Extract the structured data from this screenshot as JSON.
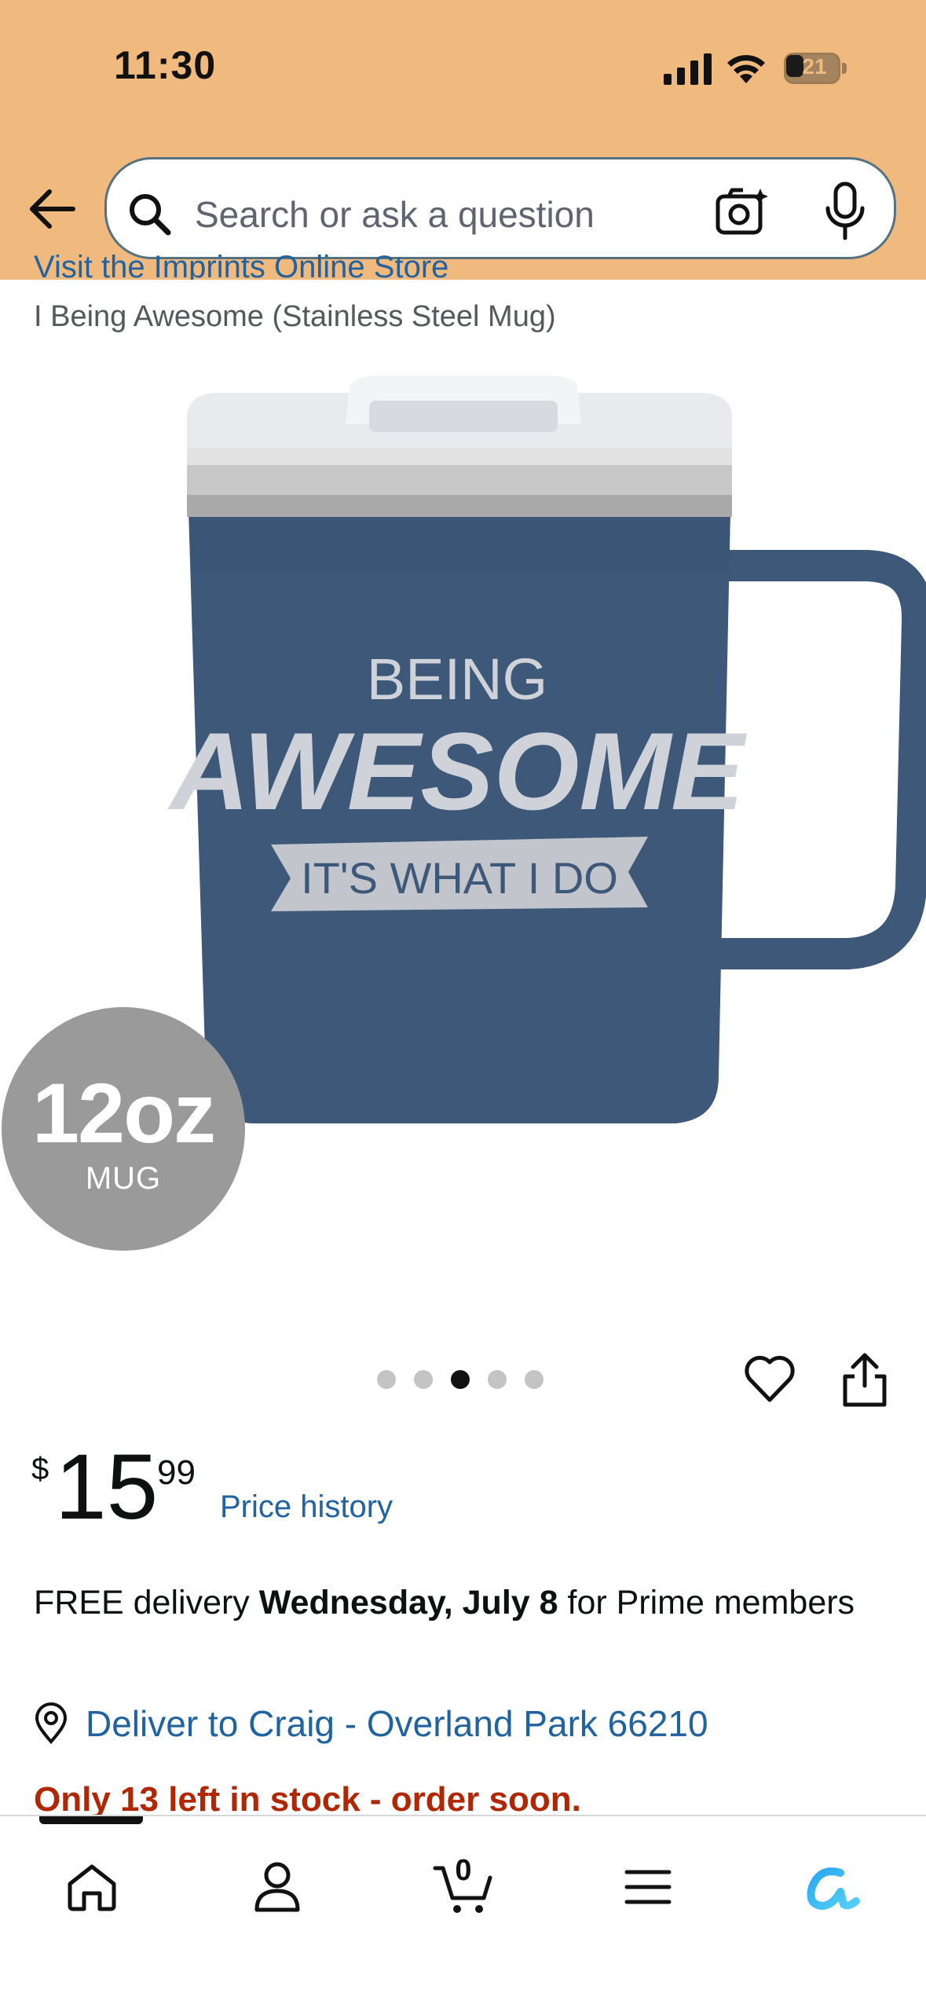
{
  "status_bar": {
    "time": "11:30",
    "battery_level": "21"
  },
  "search": {
    "placeholder": "Search or ask a question"
  },
  "store_link": "Visit the Imprints Online Store",
  "product_title": "I Being Awesome (Stainless Steel Mug)",
  "product_image": {
    "line1": "BEING",
    "line2": "AWESOME",
    "banner": "IT'S WHAT I DO"
  },
  "badge": {
    "size": "12oz",
    "label": "MUG"
  },
  "carousel": {
    "count": 5,
    "active_index": 2
  },
  "price": {
    "symbol": "$",
    "whole": "15",
    "fraction": "99",
    "history_label": "Price history"
  },
  "delivery": {
    "prefix": "FREE delivery ",
    "date": "Wednesday, July 8",
    "suffix": " for Prime members"
  },
  "deliver_to": "Deliver to Craig - Overland Park 66210",
  "stock": "Only 13 left in stock - order soon.",
  "bottom_nav": {
    "cart_count": "0",
    "items": [
      "home",
      "account",
      "cart",
      "menu",
      "rufus"
    ]
  },
  "colors": {
    "header_bg": "#f0b97e",
    "link": "#2162a1",
    "stock_red": "#b12704",
    "mug_blue": "#3d5879"
  }
}
